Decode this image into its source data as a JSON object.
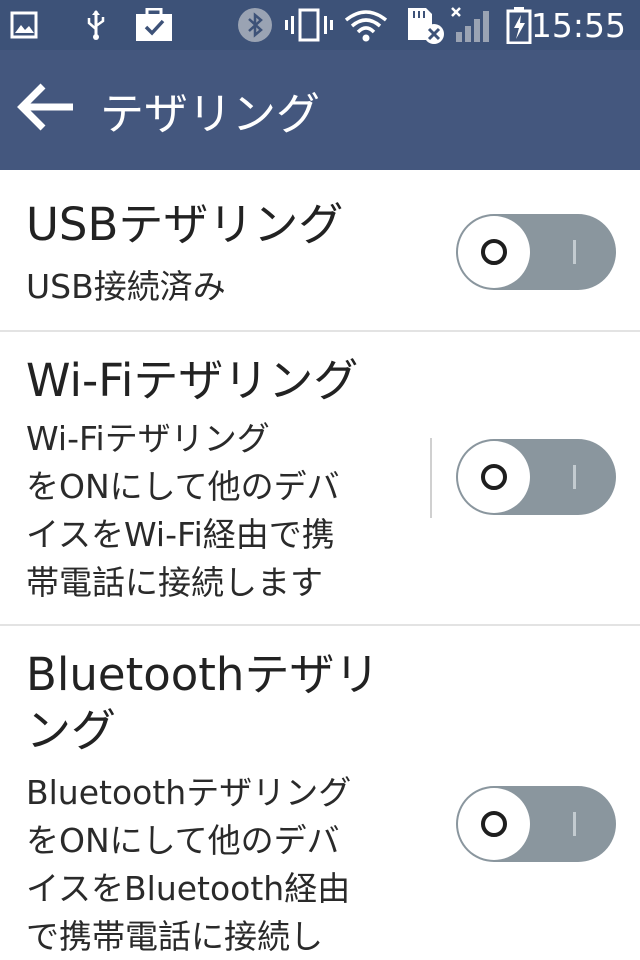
{
  "status_bar": {
    "time": "15:55",
    "icons": [
      "image-icon",
      "usb-icon",
      "clipboard-check-icon",
      "bluetooth-icon",
      "vibrate-icon",
      "wifi-icon",
      "sd-card-x-icon",
      "signal-x-icon",
      "battery-charging-icon"
    ],
    "background": "#3d5278"
  },
  "app_bar": {
    "title": "テザリング",
    "background": "#44577e"
  },
  "items": [
    {
      "title": "USBテザリング",
      "subtitle_lines": [
        "USB接続済み"
      ],
      "toggle_on": false
    },
    {
      "title": "Wi-Fiテザリング",
      "subtitle_lines": [
        "Wi-Fiテザリング",
        "をONにして他のデバ",
        "イスをWi-Fi経由で携",
        "帯電話に接続します"
      ],
      "toggle_on": false
    },
    {
      "title_lines": [
        "Bluetoothテザリ",
        "ング"
      ],
      "subtitle_lines": [
        "Bluetoothテザリング",
        "をONにして他のデバ",
        "イスをBluetooth経由",
        "で携帯電話に接続し"
      ],
      "toggle_on": false
    }
  ],
  "colors": {
    "toggle_off": "#8a969e",
    "divider": "#e3e3e3",
    "text": "#222222"
  }
}
